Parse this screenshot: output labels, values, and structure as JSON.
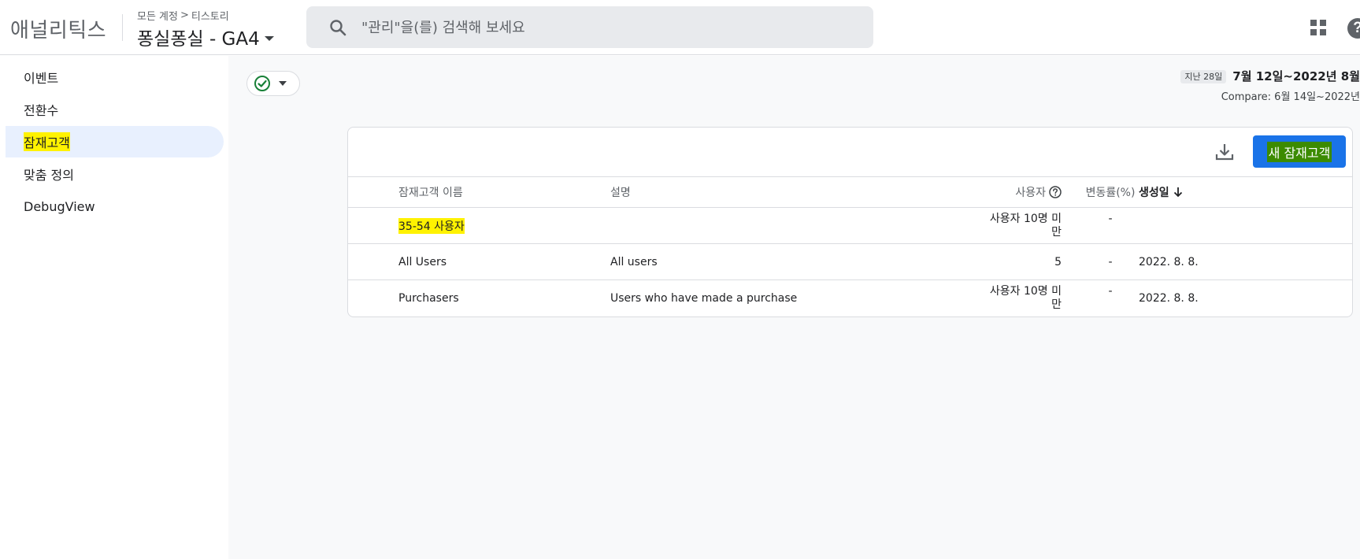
{
  "topbar": {
    "product_name": "애널리틱스",
    "breadcrumb_account": "모든 계정",
    "breadcrumb_separator": ">",
    "breadcrumb_property": "티스토리",
    "property_name": "퐁실퐁실 - GA4",
    "search_placeholder": "\"관리\"을(를) 검색해 보세요",
    "help_icon_text": "?"
  },
  "sidebar": {
    "items": [
      {
        "label": "이벤트"
      },
      {
        "label": "전환수"
      },
      {
        "label": "잠재고객"
      },
      {
        "label": "맞춤 정의"
      },
      {
        "label": "DebugView"
      }
    ]
  },
  "date_range": {
    "chip": "지난 28일",
    "range": "7월 12일~2022년 8월",
    "compare": "Compare: 6월 14일~2022년"
  },
  "card": {
    "new_audience_label": "새 잠재고객",
    "columns": {
      "name": "잠재고객 이름",
      "description": "설명",
      "users": "사용자",
      "change": "변동률(%)",
      "created": "생성일"
    },
    "rows": [
      {
        "name": "35-54 사용자",
        "description": "",
        "users_l1": "사용자 10명 미",
        "users_l2": "만",
        "change": "-",
        "created": ""
      },
      {
        "name": "All Users",
        "description": "All users",
        "users": "5",
        "change": "-",
        "created": "2022. 8. 8."
      },
      {
        "name": "Purchasers",
        "description": "Users who have made a purchase",
        "users_l1": "사용자 10명 미",
        "users_l2": "만",
        "change": "-",
        "created": "2022. 8. 8."
      }
    ]
  },
  "icons": {
    "search": "search-icon",
    "apps": "apps-grid-icon",
    "help": "help-icon",
    "check": "check-circle-icon",
    "download": "download-icon",
    "sort": "arrow-down-icon",
    "question": "question-circle-icon"
  },
  "colors": {
    "accent": "#1a73e8",
    "highlight": "#fff200",
    "success": "#188038"
  }
}
